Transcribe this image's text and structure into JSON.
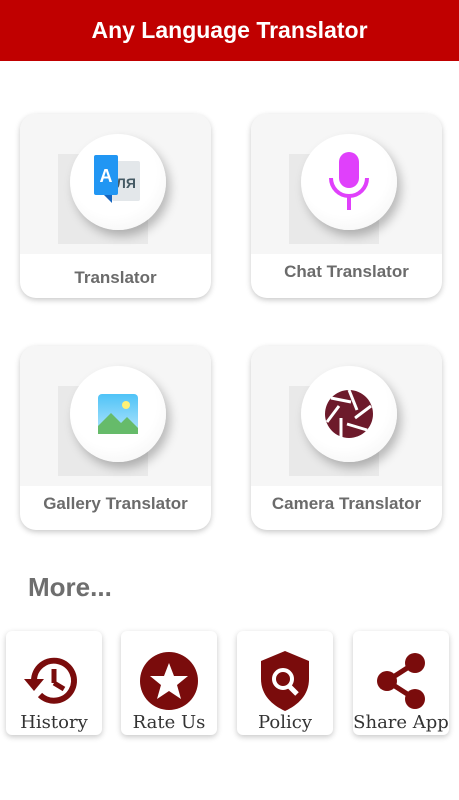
{
  "appbar": {
    "title": "Any Language Translator",
    "color": "#c00000"
  },
  "cards": [
    {
      "label": "Translator",
      "icon": "translate-icon"
    },
    {
      "label": "Chat Translator",
      "icon": "microphone-icon"
    },
    {
      "label": "Gallery Translator",
      "icon": "image-icon"
    },
    {
      "label": "Camera Translator",
      "icon": "camera-aperture-icon"
    }
  ],
  "more": {
    "label": "More..."
  },
  "bottom_actions": [
    {
      "label": "History",
      "icon": "history-icon"
    },
    {
      "label": "Rate Us",
      "icon": "star-icon"
    },
    {
      "label": "Policy",
      "icon": "shield-search-icon"
    },
    {
      "label": "Share App",
      "icon": "share-icon"
    }
  ],
  "colors": {
    "accent": "#c00000",
    "dark_red": "#7a0c0c",
    "mic": "#e040fb",
    "translate_blue": "#2196f3"
  },
  "translate_icon_text": {
    "latin": "A",
    "cyrillic": "ЛЯ"
  }
}
